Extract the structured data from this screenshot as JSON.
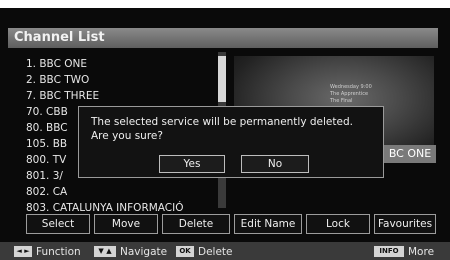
{
  "title": "Channel List",
  "channels": [
    "1. BBC ONE",
    "2. BBC TWO",
    "7. BBC THREE",
    "70. CBB",
    "80. BBC",
    "105. BB",
    "800. TV",
    "801. 3/",
    "802. CA",
    "803. CATALUNYA INFORMACIÓ"
  ],
  "preview": {
    "line1": "Wednesday 9:00",
    "line2": "The Apprentice",
    "line3": "The Final",
    "channel_label": "BC ONE"
  },
  "dialog": {
    "message_line1": "The selected service will be permanently deleted.",
    "message_line2": "Are you sure?",
    "yes_label": "Yes",
    "no_label": "No"
  },
  "function_buttons": [
    "Select",
    "Move",
    "Delete",
    "Edit Name",
    "Lock",
    "Favourites"
  ],
  "hints": {
    "left_right_keys": "◄ ►",
    "function_label": "Function",
    "up_down_keys": "▼ ▲",
    "navigate_label": "Navigate",
    "ok_key": "OK",
    "delete_label": "Delete",
    "info_key": "INFO",
    "more_label": "More"
  }
}
